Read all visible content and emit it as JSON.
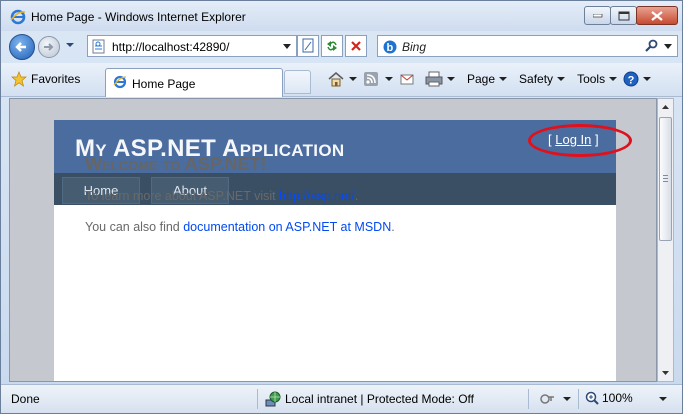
{
  "window": {
    "title": "Home Page - Windows Internet Explorer",
    "minimize_icon": "minimize-icon",
    "maximize_icon": "maximize-icon",
    "close_icon": "close-icon"
  },
  "address_bar": {
    "url": "http://localhost:42890/",
    "search_placeholder": "Bing"
  },
  "command_bar": {
    "favorites_label": "Favorites",
    "tab_title": "Home Page",
    "menus": [
      "Page",
      "Safety",
      "Tools"
    ]
  },
  "site": {
    "title": "My ASP.NET Application",
    "login_open": "[",
    "login_link": "Log In",
    "login_close": "]",
    "nav": [
      "Home",
      "About"
    ],
    "welcome": "Welcome to ASP.NET!",
    "para1_text": "To learn more about ASP.NET visit ",
    "para1_link": "http://asp.net/",
    "para1_end": ".",
    "para2_text": "You can also find ",
    "para2_link": "documentation on ASP.NET at MSDN",
    "para2_end": ".",
    "colors": {
      "header": "#4b6c9e",
      "menu": "#3a4f63",
      "link": "#034af3",
      "highlight_ring": "#e0101c"
    }
  },
  "status_bar": {
    "status": "Done",
    "zone": "Local intranet | Protected Mode: Off",
    "zoom": "100%"
  }
}
